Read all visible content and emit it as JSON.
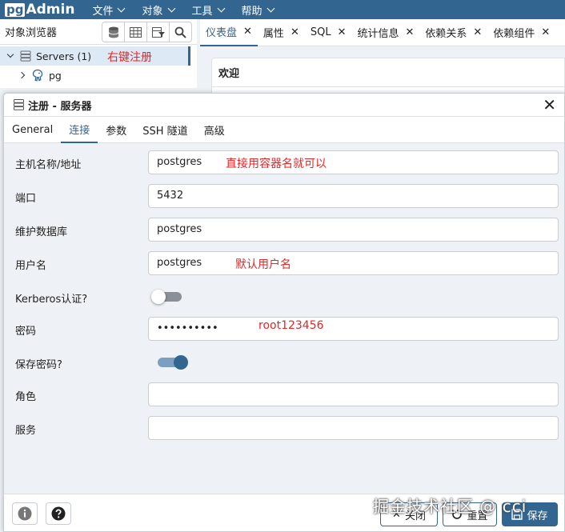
{
  "app": {
    "logo_pg": "pg",
    "logo_admin": "Admin"
  },
  "menu": [
    {
      "label": "文件"
    },
    {
      "label": "对象"
    },
    {
      "label": "工具"
    },
    {
      "label": "帮助"
    }
  ],
  "browser": {
    "title": "对象浏览器",
    "tree": [
      {
        "label": "Servers (1)"
      },
      {
        "label": "pg"
      }
    ],
    "annotation": "右键注册"
  },
  "tabs": [
    {
      "label": "仪表盘",
      "close": "✕"
    },
    {
      "label": "属性",
      "close": "✕"
    },
    {
      "label": "SQL",
      "close": "✕"
    },
    {
      "label": "统计信息",
      "close": "✕"
    },
    {
      "label": "依赖关系",
      "close": "✕"
    },
    {
      "label": "依赖组件",
      "close": "✕"
    }
  ],
  "welcome": {
    "title": "欢迎"
  },
  "dialog": {
    "title": "注册 - 服务器",
    "close": "✕",
    "tabs": [
      {
        "label": "General"
      },
      {
        "label": "连接"
      },
      {
        "label": "参数"
      },
      {
        "label": "SSH 隧道"
      },
      {
        "label": "高级"
      }
    ],
    "fields": {
      "host": {
        "label": "主机名称/地址",
        "value": "postgres",
        "annotation": "直接用容器名就可以"
      },
      "port": {
        "label": "端口",
        "value": "5432"
      },
      "maintenance_db": {
        "label": "维护数据库",
        "value": "postgres"
      },
      "username": {
        "label": "用户名",
        "value": "postgres",
        "annotation": "默认用户名"
      },
      "kerberos": {
        "label": "Kerberos认证?",
        "on": false
      },
      "password": {
        "label": "密码",
        "value": "••••••••••",
        "annotation": "root123456"
      },
      "save_password": {
        "label": "保存密码?",
        "on": true
      },
      "role": {
        "label": "角色",
        "value": ""
      },
      "service": {
        "label": "服务",
        "value": ""
      }
    },
    "footer": {
      "close_label": "关闭",
      "reset_label": "重置",
      "save_label": "保存"
    }
  },
  "watermark": "掘金技术社区 @ cci",
  "colors": {
    "primary": "#326690",
    "annotation": "#e32626",
    "background": "#eef1f5"
  }
}
